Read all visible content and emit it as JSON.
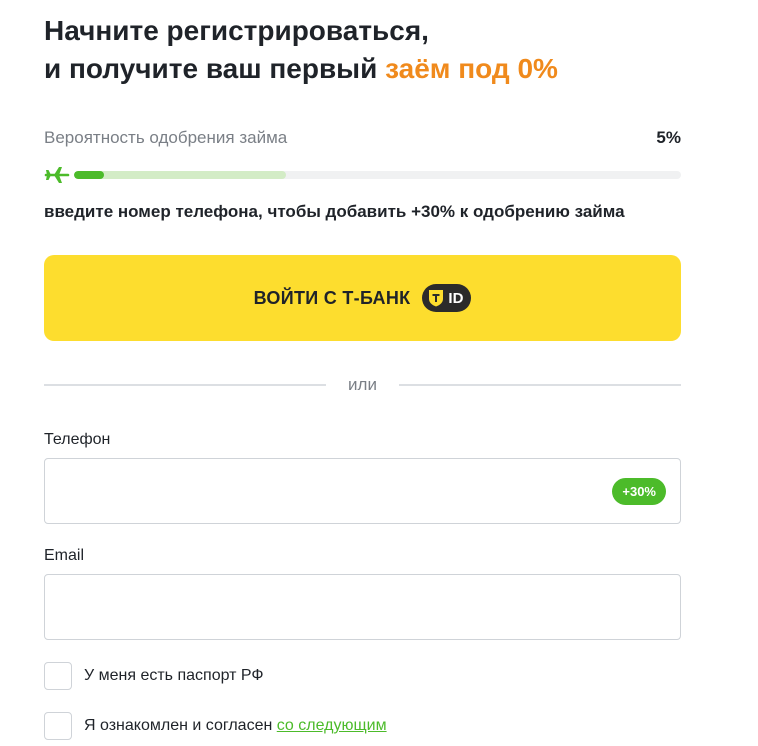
{
  "headline": {
    "line1": "Начните регистрироваться,",
    "line2_prefix": "и получите ваш первый ",
    "line2_accent": "заём под 0%"
  },
  "approval": {
    "label": "Вероятность одобрения займа",
    "value": "5%",
    "current_fraction": 0.05,
    "potential_fraction": 0.35,
    "hint": "введите номер телефона, чтобы добавить +30% к одобрению займа"
  },
  "tbank_button": {
    "label": "ВОЙТИ С Т-БАНК",
    "badge_text": "ID",
    "badge_icon": "t-shield-icon"
  },
  "divider_text": "или",
  "phone": {
    "label": "Телефон",
    "value": "",
    "placeholder": "",
    "bonus": "+30%"
  },
  "email": {
    "label": "Email",
    "value": "",
    "placeholder": ""
  },
  "checkboxes": [
    {
      "text": "У меня есть паспорт РФ",
      "checked": false
    },
    {
      "text": "Я ознакомлен и согласен ",
      "link_text": "со следующим",
      "checked": false
    }
  ],
  "colors": {
    "accent_orange": "#f08a1c",
    "brand_yellow": "#fddd2e",
    "success_green": "#4cbb2a",
    "text_dark": "#1f2329",
    "text_muted": "#7a7f86",
    "border": "#cfd3d8"
  }
}
